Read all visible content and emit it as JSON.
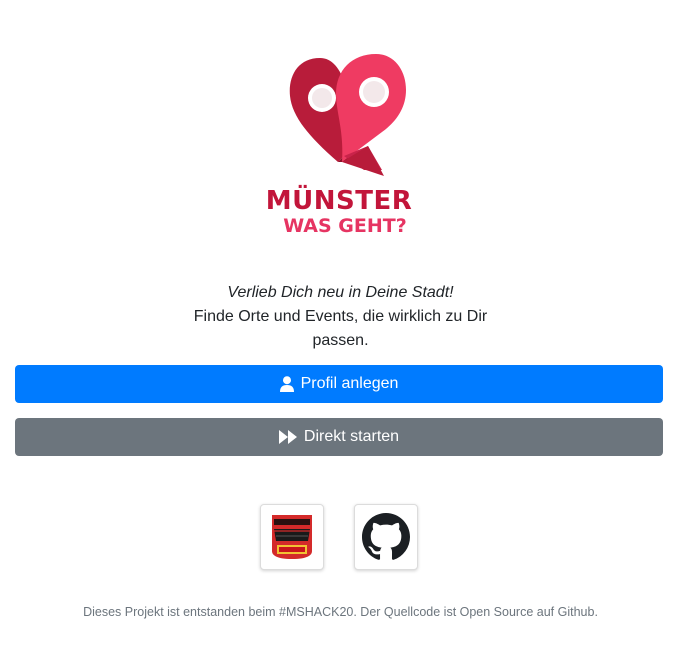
{
  "logo": {
    "line1": "MÜNSTER",
    "line2": "WAS GEHT?",
    "colors": {
      "dark_red": "#b81c3a",
      "pink": "#ef3b62"
    },
    "icon": "heart-pins-logo"
  },
  "intro": {
    "tagline": "Verlieb Dich neu in Deine Stadt!",
    "description": "Finde Orte und Events, die wirklich zu Dir passen."
  },
  "buttons": {
    "create_profile": {
      "label": "Profil anlegen",
      "icon": "user-icon",
      "color": "#007bff"
    },
    "start_direct": {
      "label": "Direkt starten",
      "icon": "fast-forward-icon",
      "color": "#6c757d"
    }
  },
  "links": {
    "mshack": {
      "icon": "mshack-logo-icon"
    },
    "github": {
      "icon": "github-icon"
    }
  },
  "footer": {
    "text": "Dieses Projekt ist entstanden beim #MSHACK20. Der Quellcode ist Open Source auf Github."
  }
}
